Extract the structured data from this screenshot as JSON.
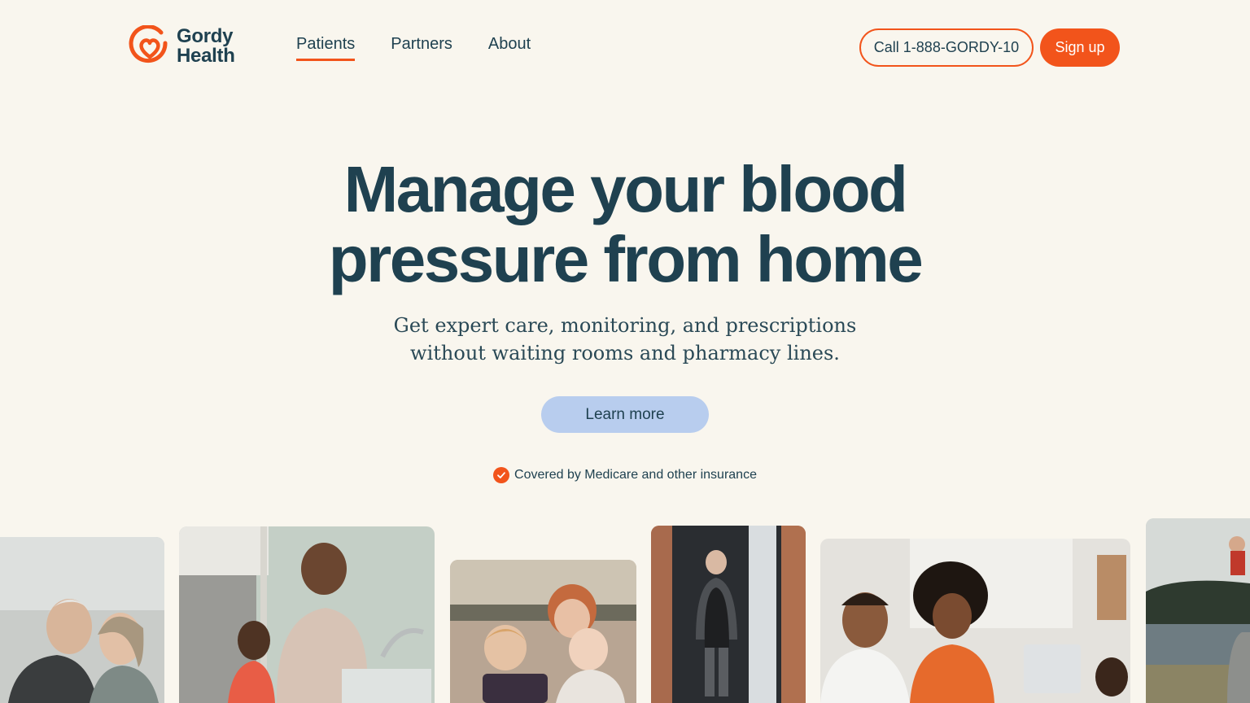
{
  "brand": {
    "name_line1": "Gordy",
    "name_line2": "Health",
    "accent_color": "#f2541b",
    "text_color": "#1f4150",
    "background_color": "#f9f6ee"
  },
  "nav": {
    "items": [
      {
        "label": "Patients",
        "active": true
      },
      {
        "label": "Partners",
        "active": false
      },
      {
        "label": "About",
        "active": false
      }
    ]
  },
  "header_actions": {
    "call_label": "Call 1-888-GORDY-10",
    "signup_label": "Sign up"
  },
  "hero": {
    "title_line1": "Manage your blood",
    "title_line2": "pressure from home",
    "subtitle_line1": "Get expert care, monitoring, and prescriptions",
    "subtitle_line2": "without waiting rooms and pharmacy lines.",
    "cta_label": "Learn more",
    "cta_color": "#b8cdee"
  },
  "coverage": {
    "icon": "check-circle-icon",
    "text": "Covered by Medicare and other insurance"
  },
  "photos": [
    {
      "subject": "older-couple-outdoors"
    },
    {
      "subject": "father-daughter-kitchen"
    },
    {
      "subject": "mother-two-kids-tablet"
    },
    {
      "subject": "older-man-doorway"
    },
    {
      "subject": "couple-dining-table"
    },
    {
      "subject": "family-outdoors-lake"
    }
  ]
}
